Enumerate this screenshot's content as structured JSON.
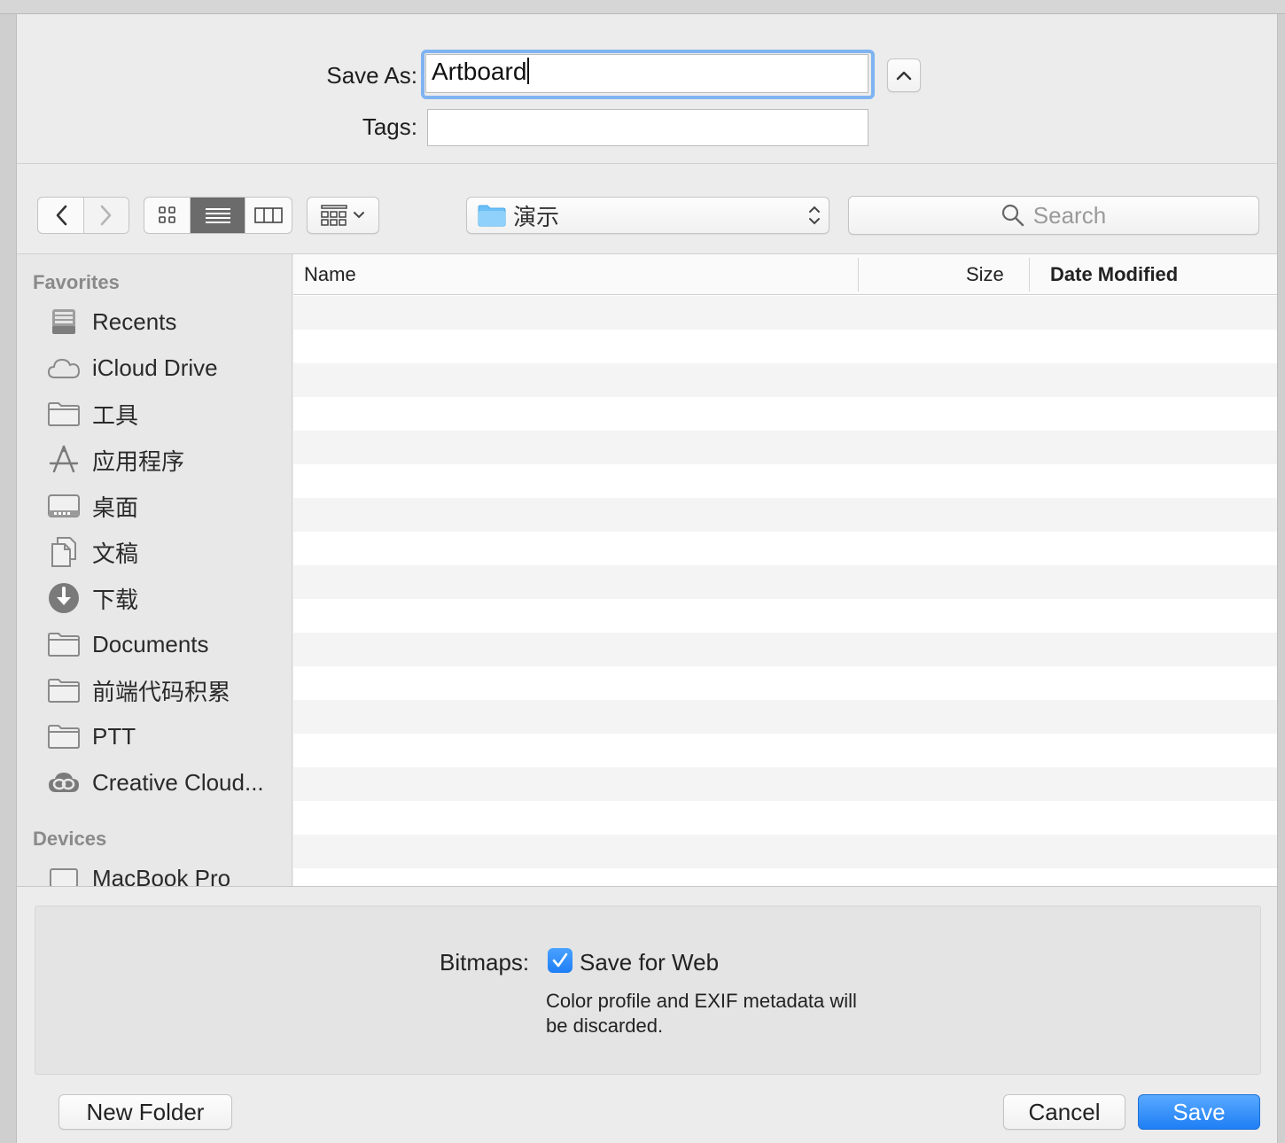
{
  "save_as": {
    "label": "Save As:",
    "value": "Artboard"
  },
  "tags": {
    "label": "Tags:",
    "value": ""
  },
  "location": {
    "folder": "演示"
  },
  "search": {
    "placeholder": "Search"
  },
  "sidebar": {
    "favorites_header": "Favorites",
    "favorites": [
      {
        "label": "Recents",
        "icon": "recents-icon"
      },
      {
        "label": "iCloud Drive",
        "icon": "cloud-icon"
      },
      {
        "label": "工具",
        "icon": "folder-icon"
      },
      {
        "label": "应用程序",
        "icon": "applications-icon"
      },
      {
        "label": "桌面",
        "icon": "desktop-icon"
      },
      {
        "label": "文稿",
        "icon": "documents-icon"
      },
      {
        "label": "下载",
        "icon": "download-icon"
      },
      {
        "label": "Documents",
        "icon": "folder-icon"
      },
      {
        "label": "前端代码积累",
        "icon": "folder-icon"
      },
      {
        "label": "PTT",
        "icon": "folder-icon"
      },
      {
        "label": "Creative Cloud...",
        "icon": "creative-cloud-icon"
      }
    ],
    "devices_header": "Devices",
    "devices": [
      {
        "label": "MacBook Pro",
        "icon": "laptop-icon"
      }
    ]
  },
  "columns": {
    "name": "Name",
    "size": "Size",
    "date": "Date Modified"
  },
  "options": {
    "bitmaps_label": "Bitmaps:",
    "save_for_web_label": "Save for Web",
    "save_for_web_checked": true,
    "note_line1": "Color profile and EXIF metadata will",
    "note_line2": "be discarded."
  },
  "buttons": {
    "new_folder": "New Folder",
    "cancel": "Cancel",
    "save": "Save"
  },
  "colors": {
    "accent": "#1e7ef5",
    "focus_ring": "#7fb3f1",
    "folder_blue": "#5fb6f5"
  }
}
